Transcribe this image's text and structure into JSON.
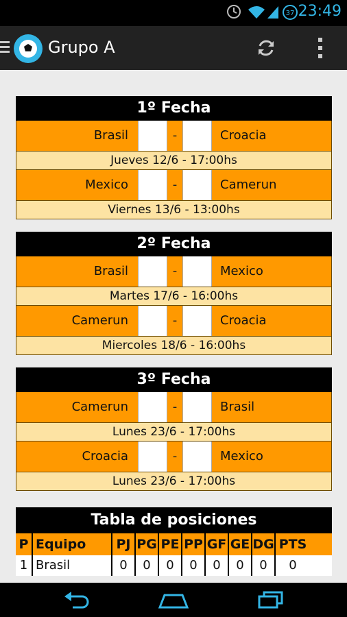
{
  "status_bar": {
    "time": "23:49",
    "icons": [
      "clock-icon",
      "wifi-icon",
      "signal-icon",
      "battery-icon"
    ],
    "battery_level": "37",
    "accent_color": "#33b5e5"
  },
  "action_bar": {
    "title": "Grupo A",
    "icons": [
      "menu-icon",
      "app-icon",
      "refresh-icon",
      "overflow-icon"
    ]
  },
  "colors": {
    "header_bg": "#000000",
    "match_bg": "#ff9900",
    "date_bg": "#fde3a3",
    "score_bg": "#ffffff"
  },
  "fixtures": [
    {
      "title": "1º Fecha",
      "matches": [
        {
          "home": "Brasil",
          "away": "Croacia",
          "home_score": "",
          "away_score": "",
          "sep": "-",
          "date": "Jueves 12/6 - 17:00hs"
        },
        {
          "home": "Mexico",
          "away": "Camerun",
          "home_score": "",
          "away_score": "",
          "sep": "-",
          "date": "Viernes 13/6 - 13:00hs"
        }
      ]
    },
    {
      "title": "2º Fecha",
      "matches": [
        {
          "home": "Brasil",
          "away": "Mexico",
          "home_score": "",
          "away_score": "",
          "sep": "-",
          "date": "Martes 17/6 - 16:00hs"
        },
        {
          "home": "Camerun",
          "away": "Croacia",
          "home_score": "",
          "away_score": "",
          "sep": "-",
          "date": "Miercoles 18/6 - 16:00hs"
        }
      ]
    },
    {
      "title": "3º Fecha",
      "matches": [
        {
          "home": "Camerun",
          "away": "Brasil",
          "home_score": "",
          "away_score": "",
          "sep": "-",
          "date": "Lunes 23/6 - 17:00hs"
        },
        {
          "home": "Croacia",
          "away": "Mexico",
          "home_score": "",
          "away_score": "",
          "sep": "-",
          "date": "Lunes 23/6 - 17:00hs"
        }
      ]
    }
  ],
  "standings": {
    "title": "Tabla de posiciones",
    "columns": [
      "P",
      "Equipo",
      "PJ",
      "PG",
      "PE",
      "PP",
      "GF",
      "GE",
      "DG",
      "PTS"
    ],
    "rows": [
      [
        "1",
        "Brasil",
        "0",
        "0",
        "0",
        "0",
        "0",
        "0",
        "0",
        "0"
      ]
    ]
  },
  "nav_bar": {
    "icons": [
      "back-icon",
      "home-icon",
      "recent-apps-icon"
    ]
  }
}
